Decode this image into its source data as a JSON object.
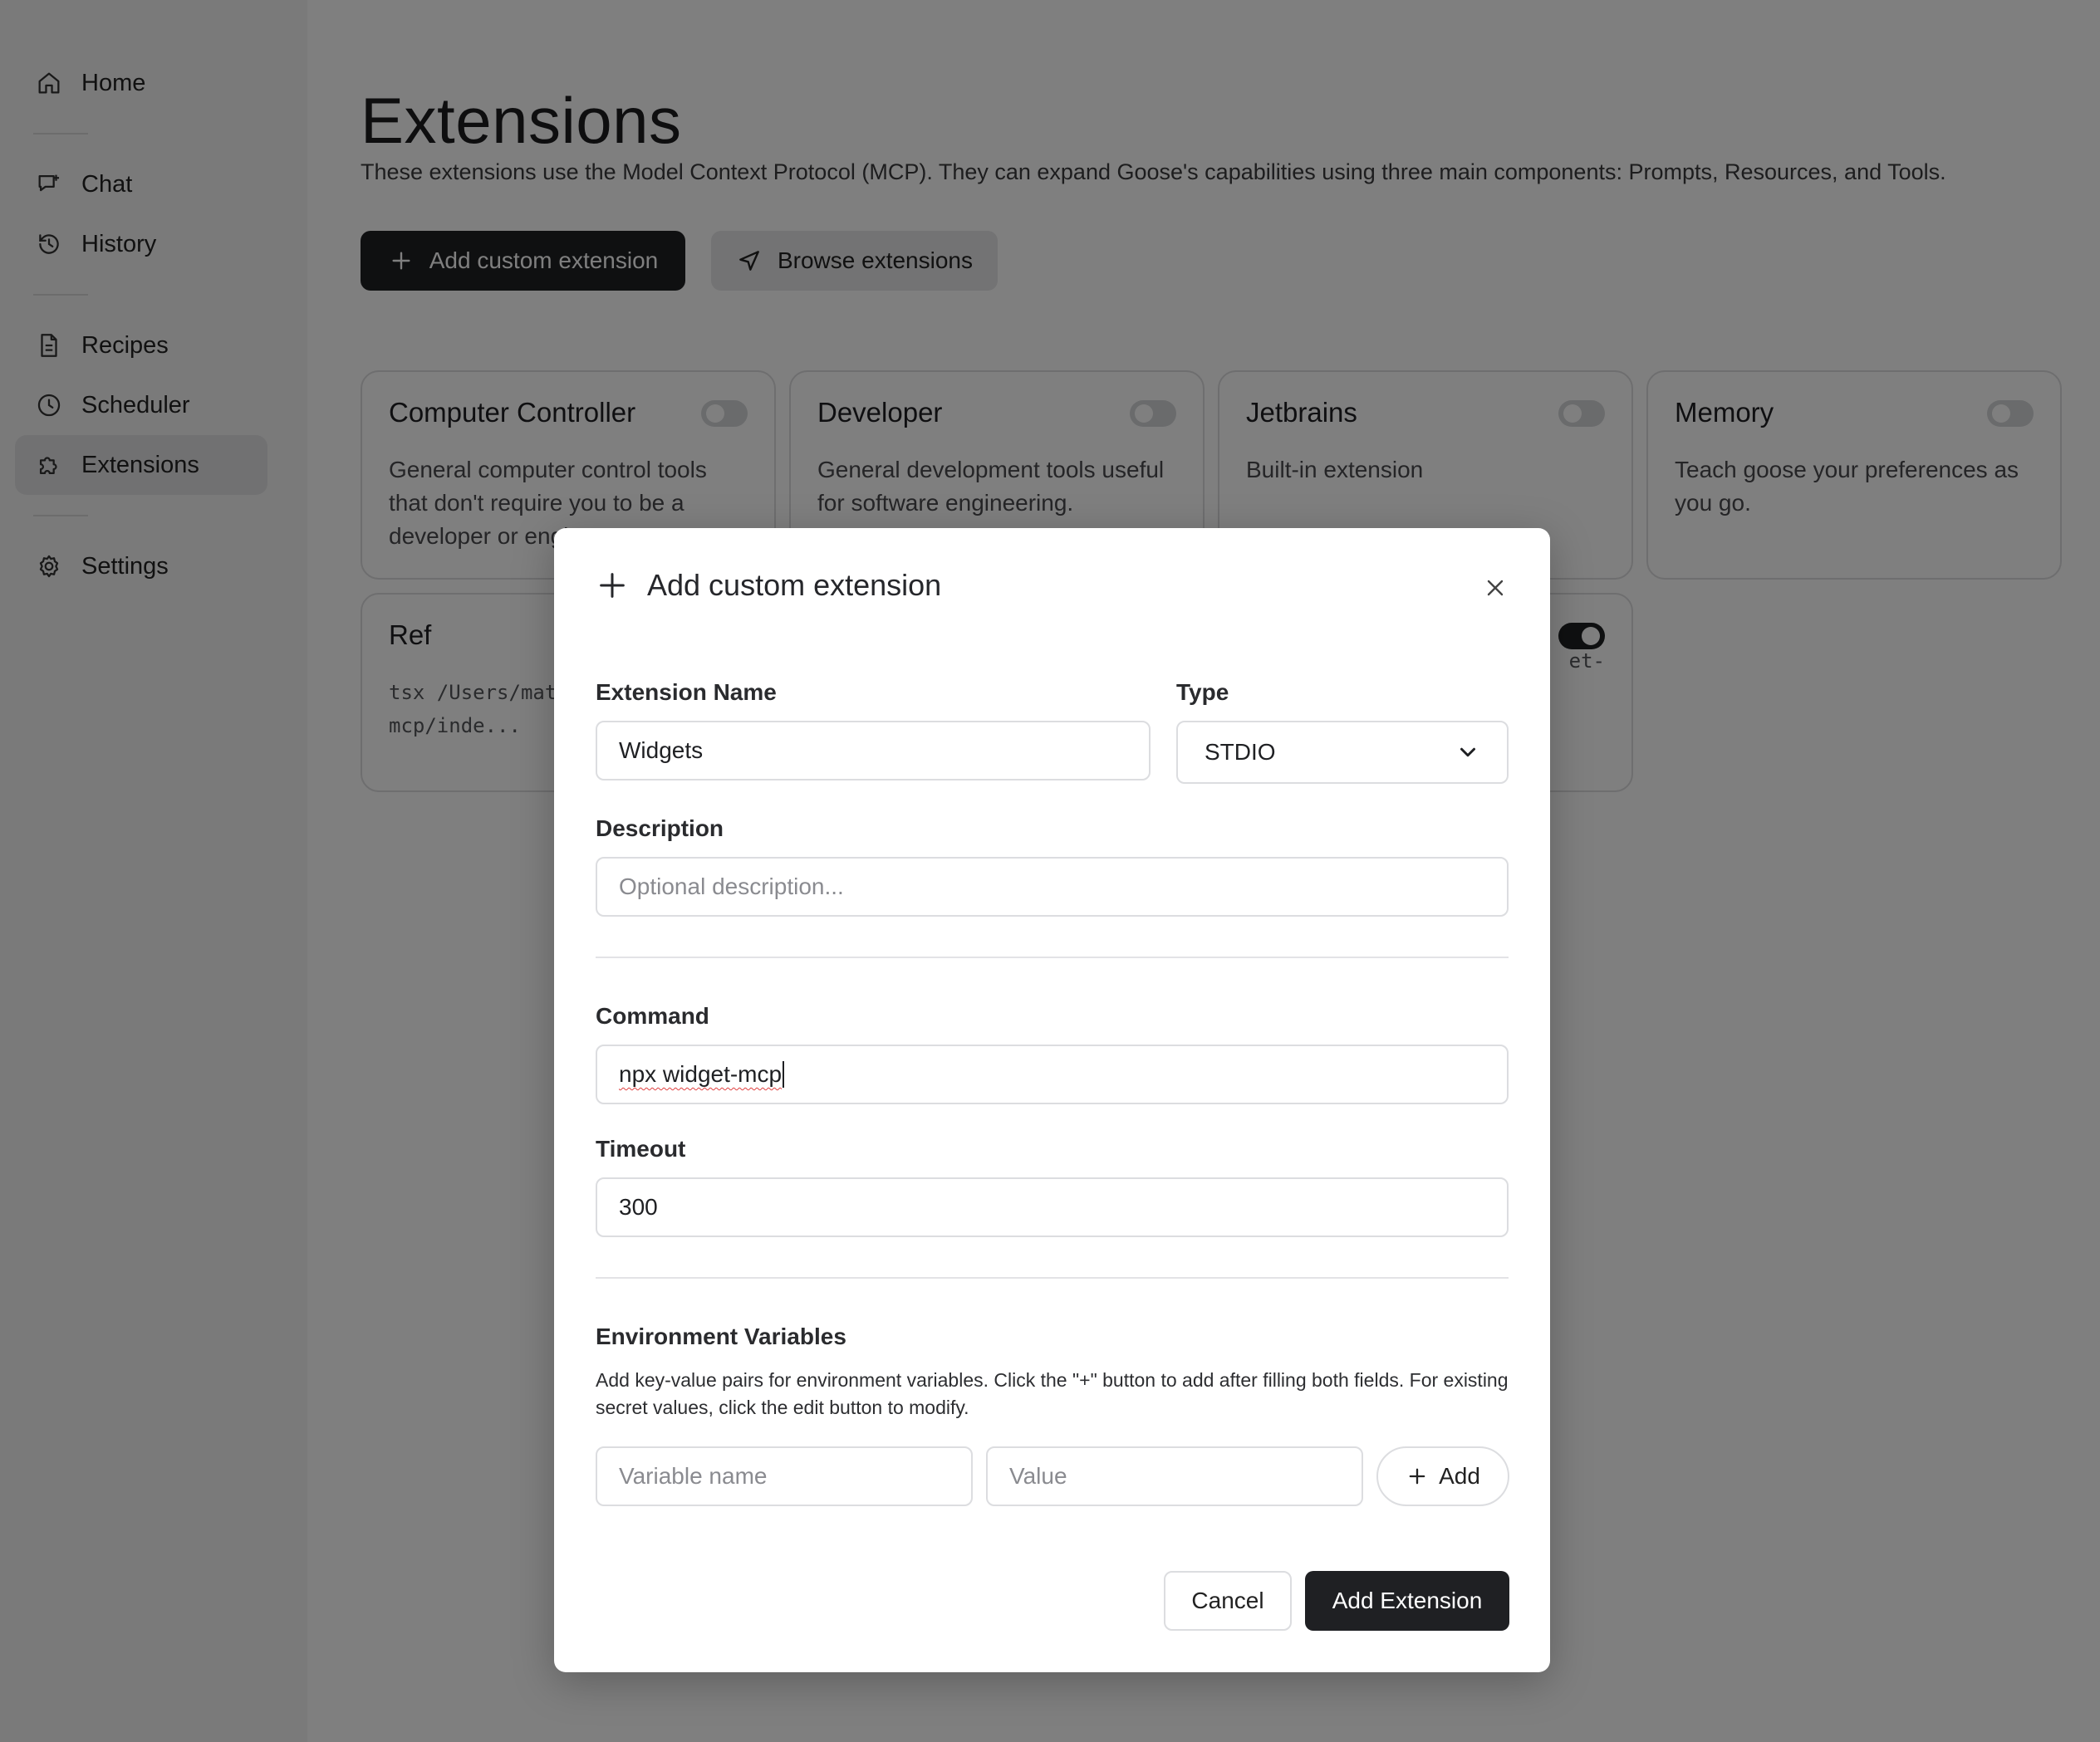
{
  "sidebar": {
    "items": [
      {
        "label": "Home",
        "icon": "home-icon"
      },
      {
        "label": "Chat",
        "icon": "chat-icon"
      },
      {
        "label": "History",
        "icon": "history-icon"
      },
      {
        "label": "Recipes",
        "icon": "document-icon"
      },
      {
        "label": "Scheduler",
        "icon": "clock-icon"
      },
      {
        "label": "Extensions",
        "icon": "puzzle-icon",
        "active": true
      },
      {
        "label": "Settings",
        "icon": "gear-icon"
      }
    ]
  },
  "page": {
    "title": "Extensions",
    "description": "These extensions use the Model Context Protocol (MCP). They can expand Goose's capabilities using three main components: Prompts, Resources, and Tools.",
    "add_button": "Add custom extension",
    "browse_button": "Browse extensions"
  },
  "cards": [
    {
      "title": "Computer Controller",
      "desc": "General computer control tools that don't require you to be a developer or engineer.",
      "enabled": false
    },
    {
      "title": "Developer",
      "desc": "General development tools useful for software engineering.",
      "enabled": false
    },
    {
      "title": "Jetbrains",
      "desc": "Built-in extension",
      "enabled": false
    },
    {
      "title": "Memory",
      "desc": "Teach goose your preferences as you go.",
      "enabled": false
    },
    {
      "title": "Ref",
      "cmd": "tsx /Users/mat... tools-mcp/inde...",
      "enabled": false
    },
    {
      "title": "",
      "cmd": "et-",
      "enabled": true
    }
  ],
  "modal": {
    "title": "Add custom extension",
    "name_label": "Extension Name",
    "name_value": "Widgets",
    "type_label": "Type",
    "type_value": "STDIO",
    "description_label": "Description",
    "description_placeholder": "Optional description...",
    "command_label": "Command",
    "command_value": "npx widget-mcp",
    "timeout_label": "Timeout",
    "timeout_value": "300",
    "env_label": "Environment Variables",
    "env_help": "Add key-value pairs for environment variables. Click the \"+\" button to add after filling both fields. For existing secret values, click the edit button to modify.",
    "var_name_placeholder": "Variable name",
    "var_value_placeholder": "Value",
    "add_var_button": "Add",
    "cancel_button": "Cancel",
    "submit_button": "Add Extension"
  }
}
